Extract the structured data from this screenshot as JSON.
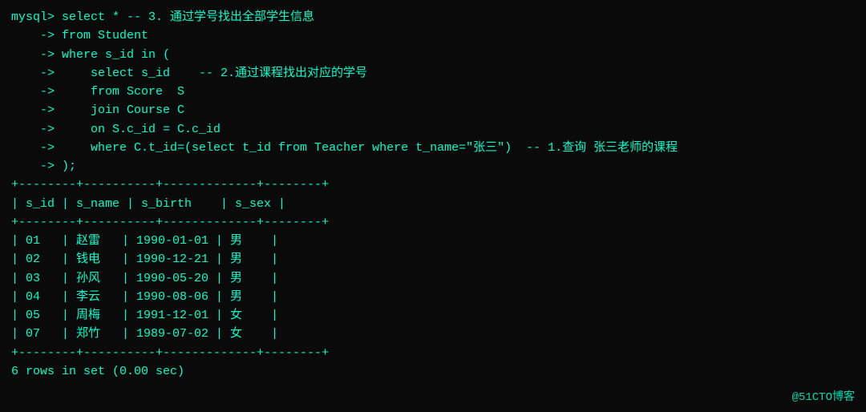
{
  "terminal": {
    "lines": [
      {
        "id": "l1",
        "text": "mysql> select * -- 3. 通过学号找出全部学生信息"
      },
      {
        "id": "l2",
        "text": "    -> from Student"
      },
      {
        "id": "l3",
        "text": "    -> where s_id in ("
      },
      {
        "id": "l4",
        "text": "    ->     select s_id    -- 2.通过课程找出对应的学号"
      },
      {
        "id": "l5",
        "text": "    ->     from Score  S"
      },
      {
        "id": "l6",
        "text": "    ->     join Course C"
      },
      {
        "id": "l7",
        "text": "    ->     on S.c_id = C.c_id"
      },
      {
        "id": "l8",
        "text": "    ->     where C.t_id=(select t_id from Teacher where t_name=\"张三\")  -- 1.查询 张三老师的课程"
      },
      {
        "id": "l9",
        "text": "    -> );"
      },
      {
        "id": "l10",
        "text": "+--------+----------+-------------+--------+"
      },
      {
        "id": "l11",
        "text": "| s_id | s_name | s_birth    | s_sex |"
      },
      {
        "id": "l12",
        "text": "+--------+----------+-------------+--------+"
      },
      {
        "id": "l13",
        "text": "| 01   | 赵雷   | 1990-01-01 | 男    |"
      },
      {
        "id": "l14",
        "text": "| 02   | 钱电   | 1990-12-21 | 男    |"
      },
      {
        "id": "l15",
        "text": "| 03   | 孙风   | 1990-05-20 | 男    |"
      },
      {
        "id": "l16",
        "text": "| 04   | 李云   | 1990-08-06 | 男    |"
      },
      {
        "id": "l17",
        "text": "| 05   | 周梅   | 1991-12-01 | 女    |"
      },
      {
        "id": "l18",
        "text": "| 07   | 郑竹   | 1989-07-02 | 女    |"
      },
      {
        "id": "l19",
        "text": "+--------+----------+-------------+--------+"
      },
      {
        "id": "l20",
        "text": "6 rows in set (0.00 sec)"
      }
    ],
    "watermark": "@51CTO博客"
  }
}
